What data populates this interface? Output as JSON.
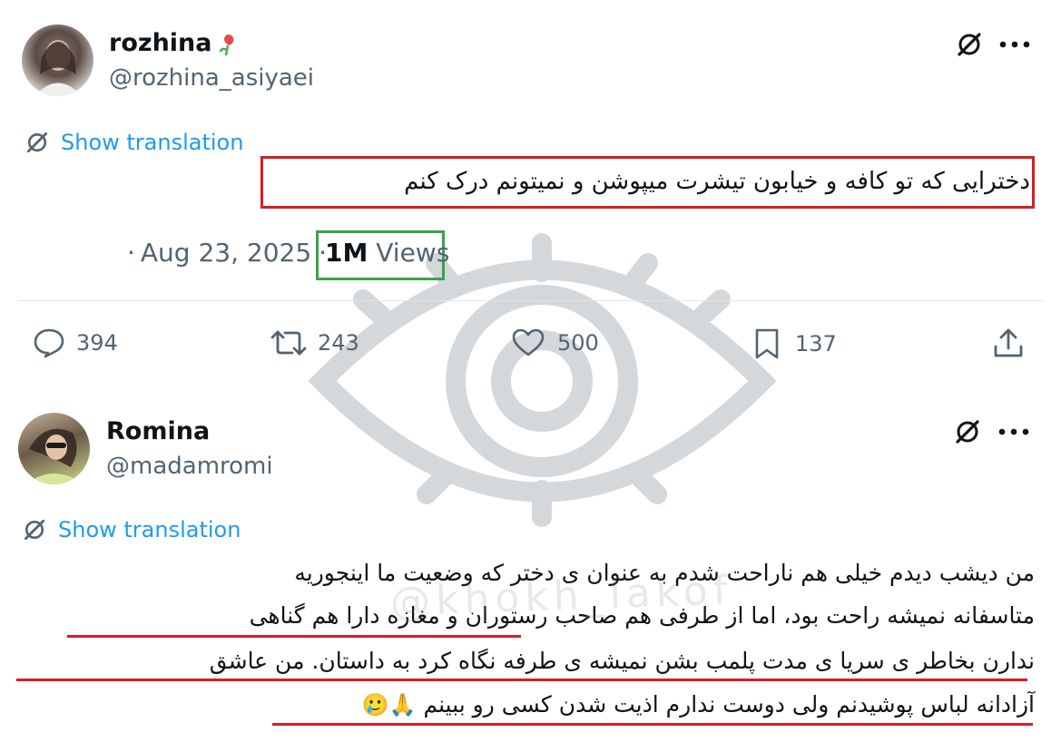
{
  "tweet1": {
    "display_name": "rozhina",
    "handle": "@rozhina_asiyaei",
    "translate_label": "Show translation",
    "text": "دخترایی که تو کافه و خیابون تیشرت میپوشن و نمیتونم درک کنم",
    "date_prefix": "·",
    "date": "Aug 23, 2025",
    "sep": "·",
    "views_count": "1M",
    "views_label": "Views",
    "replies": "394",
    "retweets": "243",
    "likes": "500",
    "bookmarks": "137"
  },
  "tweet2": {
    "display_name": "Romina",
    "handle": "@madamromi",
    "translate_label": "Show translation",
    "lines": [
      "من دیشب دیدم خیلی هم ناراحت شدم به عنوان ی دختر که وضعیت ما اینجوریه",
      "متاسفانه نمیشه راحت بود، اما از طرفی هم صاحب رستوران و مغازه دارا هم گناهی",
      "ندارن بخاطر ی سریا ی مدت پلمب بشن نمیشه ی طرفه نگاه کرد به داستان. من عاشق",
      "آزادانه لباس پوشیدنم ولی دوست ندارم اذیت شدن کسی رو ببینم"
    ],
    "emoji": "🥲🙏"
  },
  "watermark": "@khokh_lakof",
  "icons": [
    "rose-emoji-icon",
    "grok-icon",
    "more-icon",
    "translate-icon",
    "reply-icon",
    "retweet-icon",
    "like-icon",
    "bookmark-icon",
    "share-icon"
  ],
  "colors": {
    "link_blue": "#1d9bf0",
    "annotation_red": "#d31f25",
    "annotation_green": "#3aa34a",
    "secondary_text": "#536471"
  }
}
